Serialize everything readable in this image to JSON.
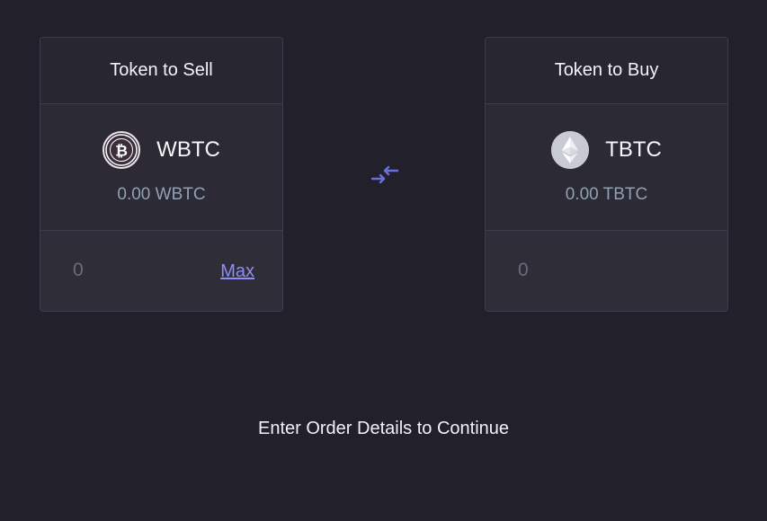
{
  "sell": {
    "header": "Token to Sell",
    "token_symbol": "WBTC",
    "token_icon": "bitcoin-icon",
    "balance": "0.00 WBTC",
    "amount_placeholder": "0",
    "max_label": "Max"
  },
  "swap": {
    "icon": "swap-arrows-icon",
    "color": "#6b70d8"
  },
  "buy": {
    "header": "Token to Buy",
    "token_symbol": "TBTC",
    "token_icon": "ethereum-icon",
    "balance": "0.00 TBTC",
    "amount_placeholder": "0"
  },
  "footer": {
    "message": "Enter Order Details to Continue"
  },
  "colors": {
    "background": "#22212b",
    "card": "#2b2a35",
    "border": "#3e3d4f",
    "balance_text": "#8fa1b4",
    "link": "#8d8ef7"
  }
}
